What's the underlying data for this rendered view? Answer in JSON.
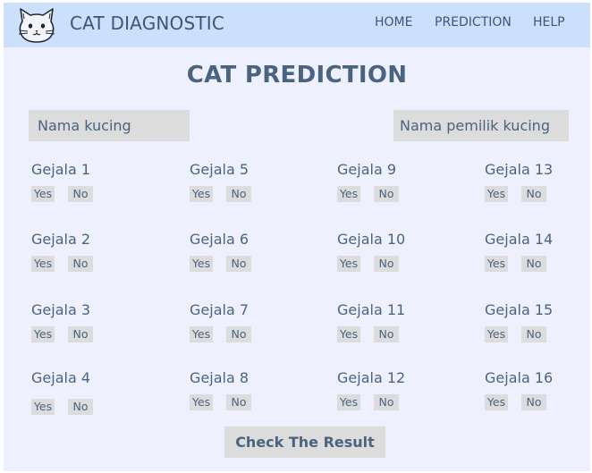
{
  "navbar": {
    "brand": "CAT DIAGNOSTIC",
    "logo_icon": "cat-face-icon",
    "links": [
      "HOME",
      "PREDICTION",
      "HELP"
    ]
  },
  "main": {
    "title": "CAT PREDICTION",
    "cat_name_placeholder": "Nama kucing",
    "owner_name_placeholder": "Nama pemilik kucing",
    "yes_label": "Yes",
    "no_label": "No",
    "symptoms": [
      "Gejala 1",
      "Gejala 2",
      "Gejala 3",
      "Gejala 4",
      "Gejala 5",
      "Gejala 6",
      "Gejala 7",
      "Gejala 8",
      "Gejala 9",
      "Gejala 10",
      "Gejala 11",
      "Gejala 12",
      "Gejala 13",
      "Gejala 14",
      "Gejala 15",
      "Gejala 16"
    ],
    "submit_label": "Check The Result"
  },
  "colors": {
    "navbar_bg": "#cde0fb",
    "page_bg": "#eef0fe",
    "text": "#4a6480",
    "control_bg": "#dcdcdc"
  }
}
